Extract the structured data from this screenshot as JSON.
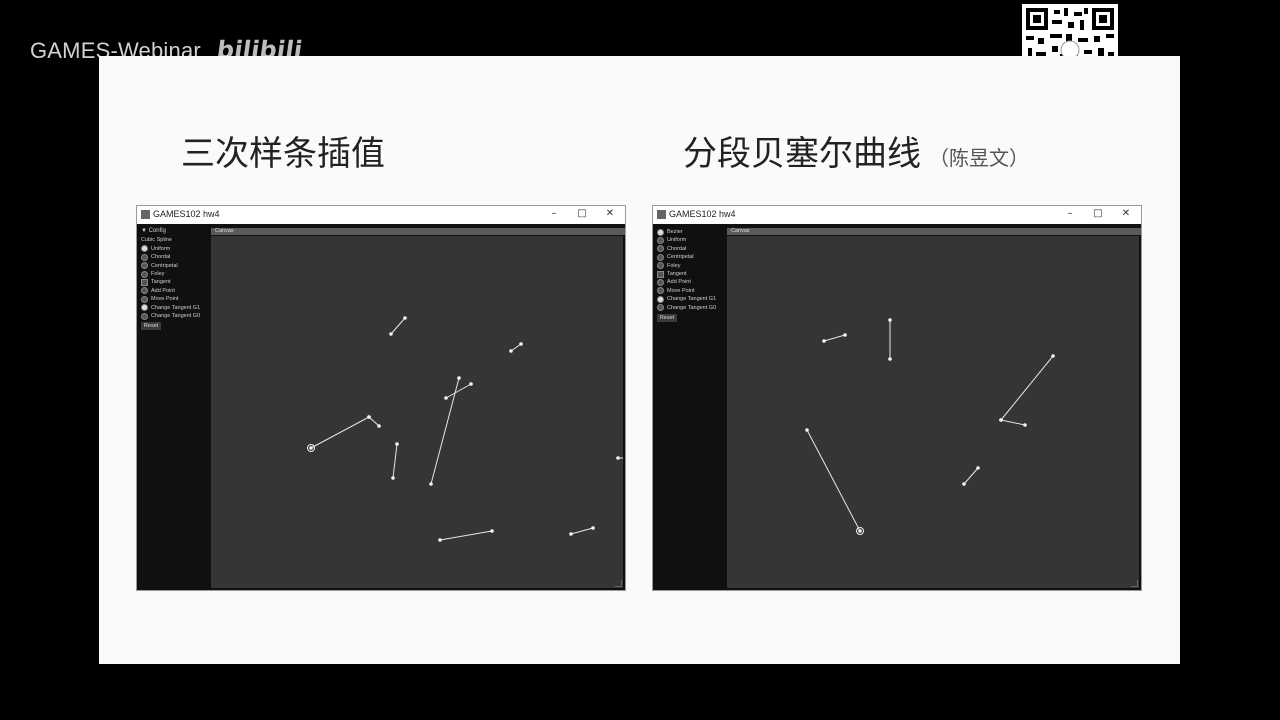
{
  "header": {
    "brand": "GAMES-Webinar",
    "bili_logo": "bilibili"
  },
  "slide": {
    "left_title": "三次样条插值",
    "right_title": "分段贝塞尔曲线",
    "right_author": "（陈昱文）"
  },
  "windows": [
    {
      "title": "GAMES102 hw4",
      "panel_items": [
        {
          "label": "Config",
          "kind": "head"
        },
        {
          "label": "Cubic Spline",
          "kind": "text"
        },
        {
          "label": "Uniform",
          "kind": "radio",
          "on": true
        },
        {
          "label": "Chordal",
          "kind": "radio",
          "on": false
        },
        {
          "label": "Centripetal",
          "kind": "radio",
          "on": false
        },
        {
          "label": "Foley",
          "kind": "radio",
          "on": false
        },
        {
          "label": "Tangent",
          "kind": "box"
        },
        {
          "label": "Add Point",
          "kind": "radio",
          "on": false
        },
        {
          "label": "Move Point",
          "kind": "radio",
          "on": false
        },
        {
          "label": "Change Tangent G1",
          "kind": "radio",
          "on": true
        },
        {
          "label": "Change Tangent G0",
          "kind": "radio",
          "on": false
        }
      ],
      "reset_label": "Reset",
      "canvas_label": "Canvas",
      "segments": [
        [
          180,
          98,
          194,
          82
        ],
        [
          300,
          115,
          310,
          108
        ],
        [
          235,
          162,
          260,
          148
        ],
        [
          100,
          212,
          158,
          181
        ],
        [
          158,
          181,
          168,
          190
        ],
        [
          186,
          208,
          182,
          242
        ],
        [
          248,
          142,
          220,
          248
        ],
        [
          407,
          222,
          426,
          222
        ],
        [
          229,
          304,
          281,
          295
        ],
        [
          360,
          298,
          382,
          292
        ]
      ],
      "highlight": [
        100,
        212
      ]
    },
    {
      "title": "GAMES102 hw4",
      "panel_items": [
        {
          "label": "Bezier",
          "kind": "radio",
          "on": true
        },
        {
          "label": "Uniform",
          "kind": "radio",
          "on": false
        },
        {
          "label": "Chordal",
          "kind": "radio",
          "on": false
        },
        {
          "label": "Centripetal",
          "kind": "radio",
          "on": false
        },
        {
          "label": "Foley",
          "kind": "radio",
          "on": false
        },
        {
          "label": "Tangent",
          "kind": "box"
        },
        {
          "label": "Add Point",
          "kind": "radio",
          "on": false
        },
        {
          "label": "Move Point",
          "kind": "radio",
          "on": false
        },
        {
          "label": "Change Tangent G1",
          "kind": "radio",
          "on": true
        },
        {
          "label": "Change Tangent G0",
          "kind": "radio",
          "on": false
        }
      ],
      "reset_label": "Reset",
      "canvas_label": "Canvas",
      "segments": [
        [
          97,
          105,
          118,
          99
        ],
        [
          163,
          84,
          163,
          123
        ],
        [
          326,
          120,
          274,
          184
        ],
        [
          274,
          184,
          298,
          189
        ],
        [
          80,
          194,
          133,
          295
        ],
        [
          237,
          248,
          251,
          232
        ]
      ],
      "highlight": [
        133,
        295
      ]
    }
  ]
}
